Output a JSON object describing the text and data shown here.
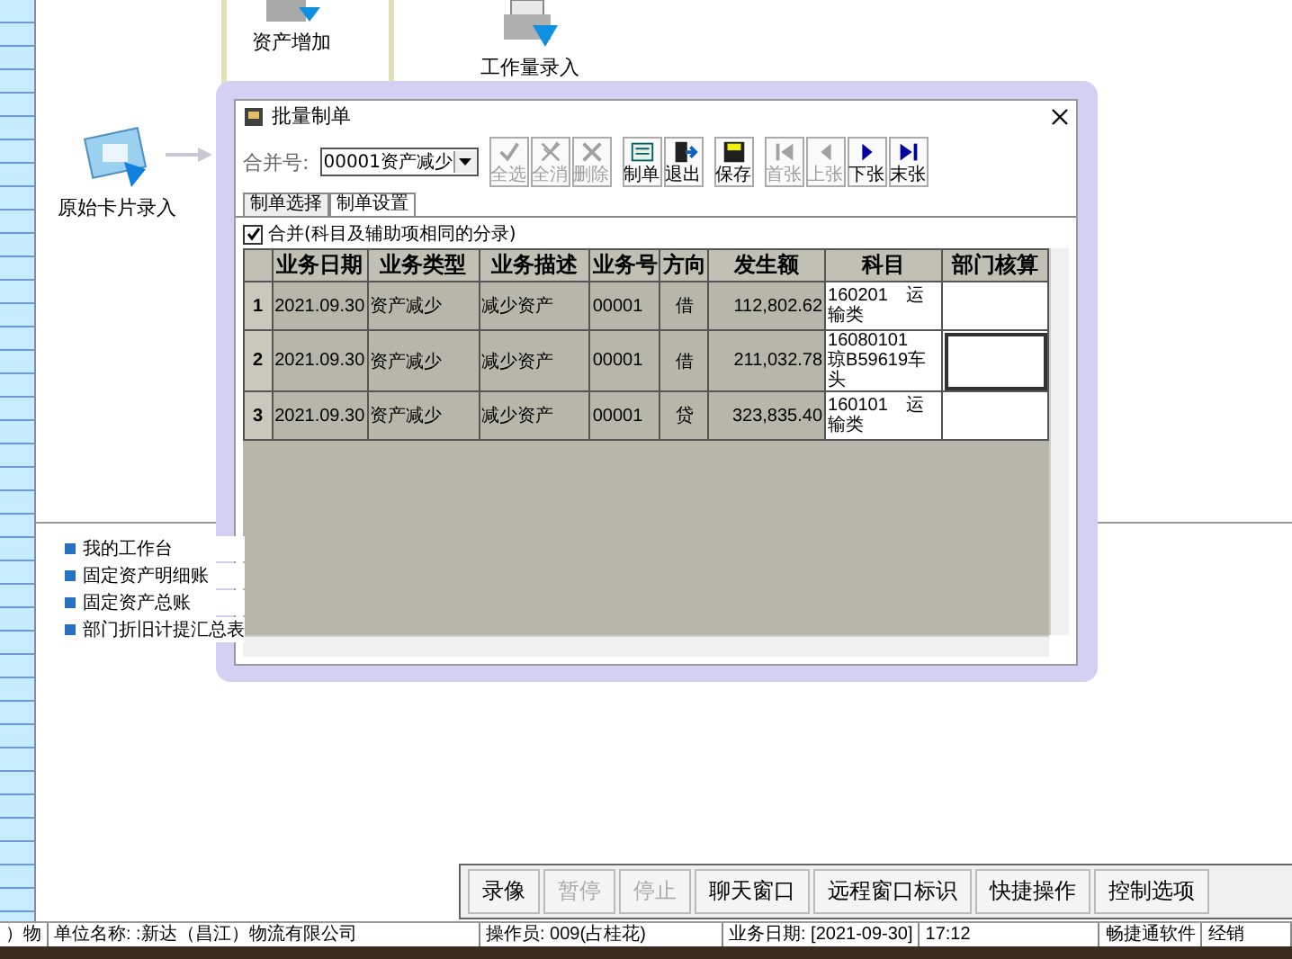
{
  "diagram": {
    "nodes": [
      {
        "label": "资产增加",
        "kind": "asset"
      },
      {
        "label": "工作量录入",
        "kind": "printer"
      },
      {
        "label": "原始卡片录入",
        "kind": "card"
      }
    ]
  },
  "links": [
    "我的工作台",
    "固定资产明细账",
    "固定资产总账",
    "部门折旧计提汇总表"
  ],
  "dialog": {
    "title": "批量制单",
    "merge_label": "合并号:",
    "merge_value": "00001资产减少",
    "toolbar": [
      {
        "label": "全选",
        "disabled": true
      },
      {
        "label": "全消",
        "disabled": true
      },
      {
        "label": "删除",
        "disabled": true
      },
      {
        "label": "制单",
        "disabled": false
      },
      {
        "label": "退出",
        "disabled": false
      },
      {
        "label": "保存",
        "disabled": false
      },
      {
        "label": "首张",
        "disabled": true
      },
      {
        "label": "上张",
        "disabled": true
      },
      {
        "label": "下张",
        "disabled": false
      },
      {
        "label": "末张",
        "disabled": false
      }
    ],
    "tabs": [
      {
        "label": "制单选择",
        "selected": false
      },
      {
        "label": "制单设置",
        "selected": true
      }
    ],
    "merge_option": {
      "label": "合并(科目及辅助项相同的分录)",
      "checked": true
    },
    "table": {
      "columns": [
        "业务日期",
        "业务类型",
        "业务描述",
        "业务号",
        "方向",
        "发生额",
        "科目",
        "部门核算"
      ],
      "rows": [
        {
          "index": "1",
          "date": "2021.09.30",
          "type": "资产减少",
          "desc": "减少资产",
          "number": "00001",
          "direction": "借",
          "amount": "112,802.62",
          "subject": "160201　运输类",
          "focused": false
        },
        {
          "index": "2",
          "date": "2021.09.30",
          "type": "资产减少",
          "desc": "减少资产",
          "number": "00001",
          "direction": "借",
          "amount": "211,032.78",
          "subject": "16080101　琼B59619车头",
          "focused": true
        },
        {
          "index": "3",
          "date": "2021.09.30",
          "type": "资产减少",
          "desc": "减少资产",
          "number": "00001",
          "direction": "贷",
          "amount": "323,835.40",
          "subject": "160101　运输类",
          "focused": false
        }
      ]
    }
  },
  "remote_toolbar": [
    {
      "label": "录像",
      "disabled": false
    },
    {
      "label": "暂停",
      "disabled": true
    },
    {
      "label": "停止",
      "disabled": true
    },
    {
      "label": "聊天窗口",
      "disabled": false
    },
    {
      "label": "远程窗口标识",
      "disabled": false
    },
    {
      "label": "快捷操作",
      "disabled": false
    },
    {
      "label": "控制选项",
      "disabled": false
    }
  ],
  "status_bar": [
    "）物",
    "单位名称: :新达（昌江）物流有限公司",
    "操作员: 009(占桂花)",
    "业务日期: [2021-09-30]",
    "17:12",
    "畅捷通软件",
    "经销"
  ]
}
